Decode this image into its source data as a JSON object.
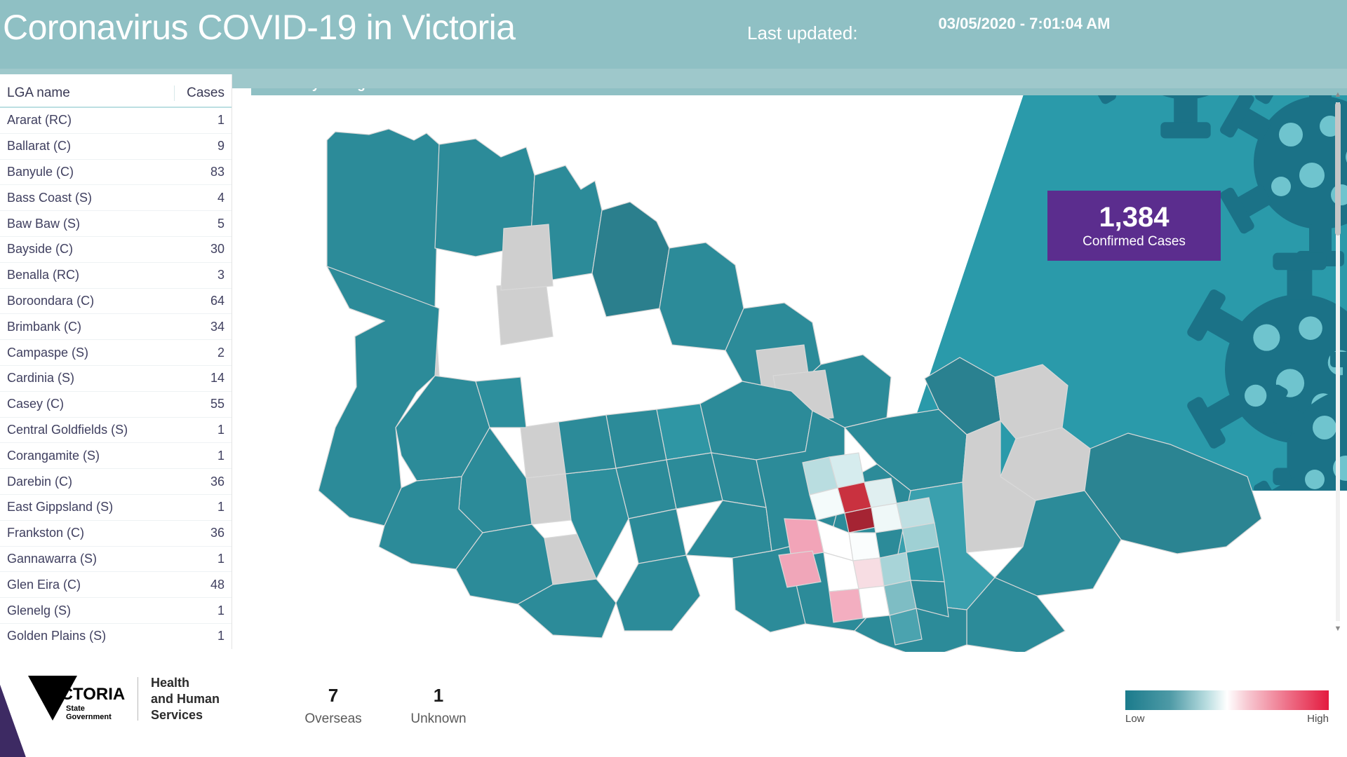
{
  "header": {
    "title": "Coronavirus COVID-19 in Victoria",
    "updated_label": "Last updated:",
    "updated_value": "03/05/2020 - 7:01:04 AM"
  },
  "sidebar": {
    "columns": {
      "name": "LGA name",
      "cases": "Cases"
    },
    "scroll": {
      "up_icon": "chevron-up-icon",
      "down_icon": "chevron-down-icon"
    },
    "rows": [
      {
        "name": "Ararat (RC)",
        "cases": "1"
      },
      {
        "name": "Ballarat (C)",
        "cases": "9"
      },
      {
        "name": "Banyule (C)",
        "cases": "83"
      },
      {
        "name": "Bass Coast (S)",
        "cases": "4"
      },
      {
        "name": "Baw Baw (S)",
        "cases": "5"
      },
      {
        "name": "Bayside (C)",
        "cases": "30"
      },
      {
        "name": "Benalla (RC)",
        "cases": "3"
      },
      {
        "name": "Boroondara (C)",
        "cases": "64"
      },
      {
        "name": "Brimbank (C)",
        "cases": "34"
      },
      {
        "name": "Campaspe (S)",
        "cases": "2"
      },
      {
        "name": "Cardinia (S)",
        "cases": "14"
      },
      {
        "name": "Casey (C)",
        "cases": "55"
      },
      {
        "name": "Central Goldfields (S)",
        "cases": "1"
      },
      {
        "name": "Corangamite (S)",
        "cases": "1"
      },
      {
        "name": "Darebin (C)",
        "cases": "36"
      },
      {
        "name": "East Gippsland (S)",
        "cases": "1"
      },
      {
        "name": "Frankston (C)",
        "cases": "36"
      },
      {
        "name": "Gannawarra (S)",
        "cases": "1"
      },
      {
        "name": "Glen Eira (C)",
        "cases": "48"
      },
      {
        "name": "Glenelg (S)",
        "cases": "1"
      },
      {
        "name": "Golden Plains (S)",
        "cases": "1"
      }
    ]
  },
  "map": {
    "title": "Cases by local government area"
  },
  "kpi": {
    "value": "1,384",
    "label": "Confirmed Cases",
    "color": "#5b2d8e"
  },
  "bottom_stats": [
    {
      "value": "7",
      "label": "Overseas"
    },
    {
      "value": "1",
      "label": "Unknown"
    }
  ],
  "legend": {
    "low": "Low",
    "high": "High",
    "low_color": "#1b7b8c",
    "high_color": "#e31b3f"
  },
  "logo": {
    "wordmark": "VICTORIA",
    "line1": "State",
    "line2": "Government",
    "department": "Health\nand Human\nServices"
  },
  "chart_data": {
    "type": "heatmap",
    "title": "Cases by local government area",
    "legend_low": "Low",
    "legend_high": "High",
    "total_confirmed": 1384,
    "overseas": 7,
    "unknown": 1,
    "categories": [
      "Ararat (RC)",
      "Ballarat (C)",
      "Banyule (C)",
      "Bass Coast (S)",
      "Baw Baw (S)",
      "Bayside (C)",
      "Benalla (RC)",
      "Boroondara (C)",
      "Brimbank (C)",
      "Campaspe (S)",
      "Cardinia (S)",
      "Casey (C)",
      "Central Goldfields (S)",
      "Corangamite (S)",
      "Darebin (C)",
      "East Gippsland (S)",
      "Frankston (C)",
      "Gannawarra (S)",
      "Glen Eira (C)",
      "Glenelg (S)",
      "Golden Plains (S)"
    ],
    "values": [
      1,
      9,
      83,
      4,
      5,
      30,
      3,
      64,
      34,
      2,
      14,
      55,
      1,
      1,
      36,
      1,
      36,
      1,
      48,
      1,
      1
    ]
  }
}
